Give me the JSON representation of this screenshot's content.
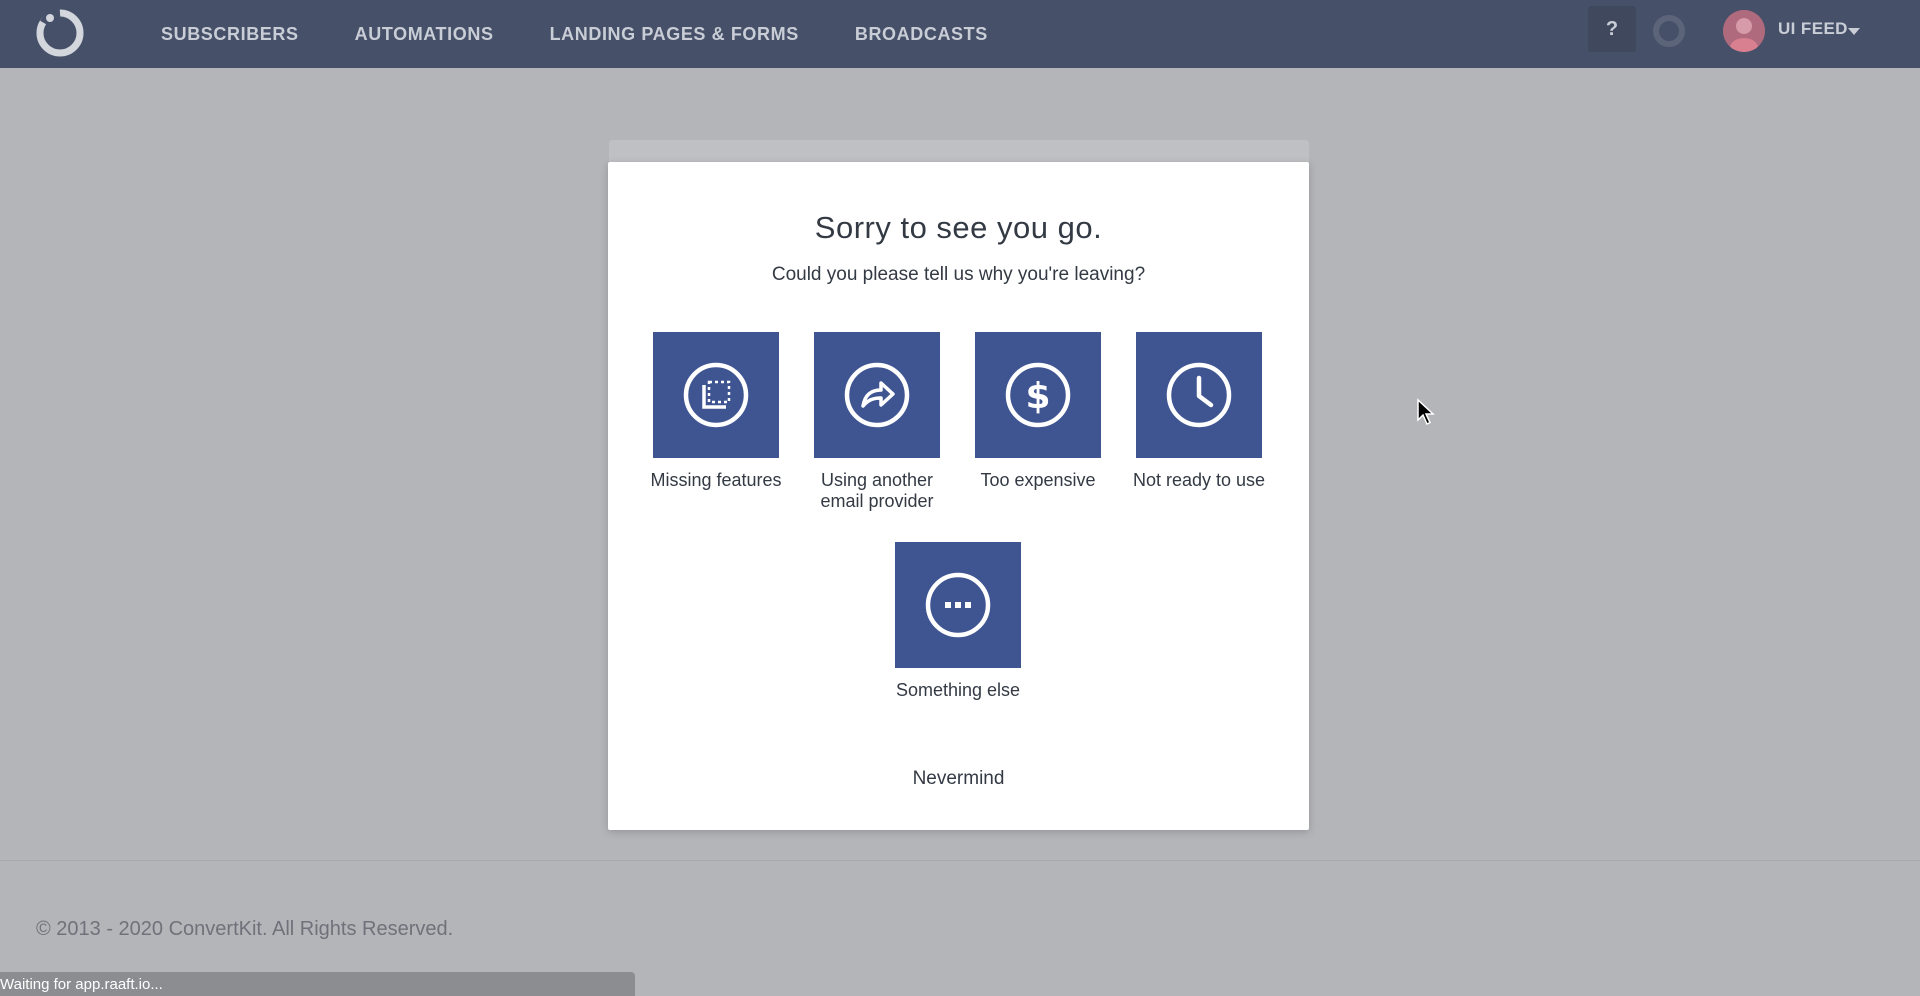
{
  "nav": {
    "links": [
      "SUBSCRIBERS",
      "AUTOMATIONS",
      "LANDING PAGES & FORMS",
      "BROADCASTS"
    ],
    "help_label": "?",
    "user_name": "UI FEED"
  },
  "modal": {
    "title": "Sorry to see you go.",
    "subtitle": "Could you please tell us why you're leaving?",
    "options": [
      {
        "label": "Missing features",
        "icon": "missing-features-icon"
      },
      {
        "label": "Using another email provider",
        "icon": "share-arrow-icon"
      },
      {
        "label": "Too expensive",
        "icon": "dollar-icon"
      },
      {
        "label": "Not ready to use",
        "icon": "clock-icon"
      },
      {
        "label": "Something else",
        "icon": "ellipsis-icon"
      }
    ],
    "nevermind_label": "Nevermind"
  },
  "footer": {
    "copyright": "© 2013 - 2020 ConvertKit. All Rights Reserved."
  },
  "browser": {
    "status_text": "Waiting for app.raaft.io..."
  },
  "colors": {
    "nav_bg": "#465068",
    "tile_bg": "#3f5592",
    "overlay": "#b4b5b9"
  }
}
